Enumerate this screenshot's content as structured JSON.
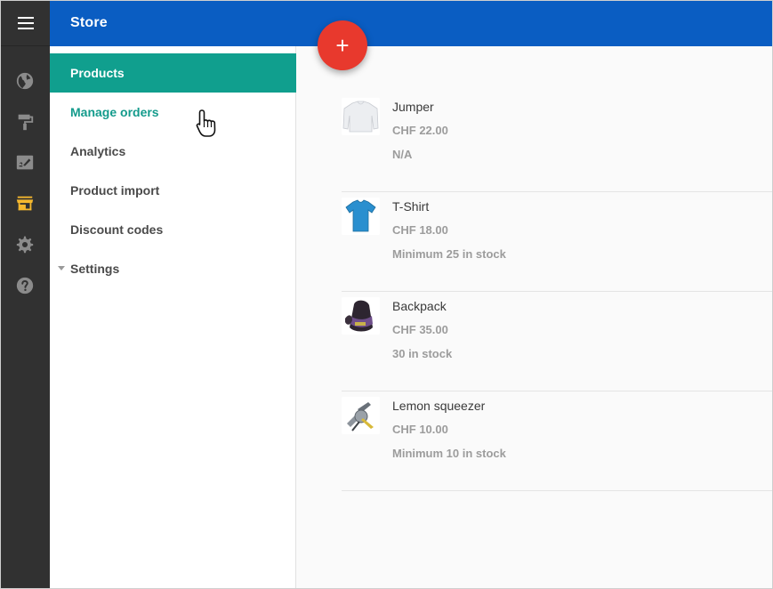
{
  "appbar": {
    "title": "Store",
    "menu_icon": "hamburger-menu-icon"
  },
  "rail": {
    "icons": [
      "globe-icon",
      "paint-roller-icon",
      "signature-icon",
      "store-icon",
      "gear-icon",
      "help-icon"
    ],
    "active_icon": "store-icon",
    "active_color": "#f5b82e"
  },
  "nav": {
    "items": [
      {
        "label": "Products",
        "state": "active"
      },
      {
        "label": "Manage orders",
        "state": "hover"
      },
      {
        "label": "Analytics"
      },
      {
        "label": "Product import"
      },
      {
        "label": "Discount codes"
      },
      {
        "label": "Settings",
        "expandable": true
      }
    ]
  },
  "fab": {
    "label": "+",
    "icon": "plus-icon",
    "color": "#e8392d"
  },
  "products": [
    {
      "name": "Jumper",
      "price": "CHF 22.00",
      "stock": "N/A",
      "thumb": "jumper-thumbnail"
    },
    {
      "name": "T-Shirt",
      "price": "CHF 18.00",
      "stock": "Minimum 25 in stock",
      "thumb": "tshirt-thumbnail"
    },
    {
      "name": "Backpack",
      "price": "CHF 35.00",
      "stock": "30 in stock",
      "thumb": "backpack-thumbnail"
    },
    {
      "name": "Lemon squeezer",
      "price": "CHF 10.00",
      "stock": "Minimum 10 in stock",
      "thumb": "lemon-squeezer-thumbnail"
    }
  ],
  "colors": {
    "appbar": "#0a5dc2",
    "accent": "#109f8e",
    "rail": "#313131"
  }
}
